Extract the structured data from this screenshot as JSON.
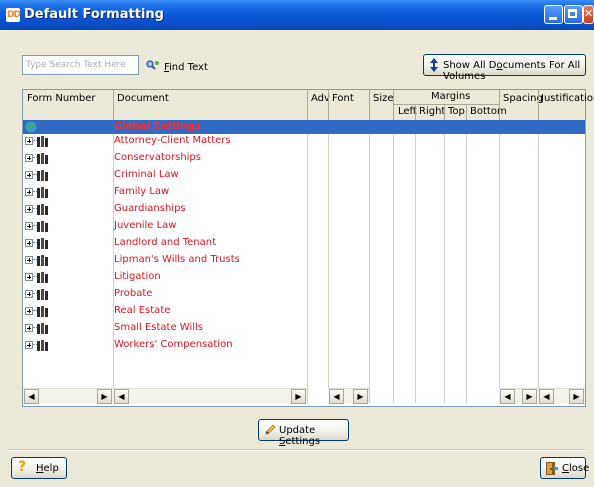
{
  "window": {
    "title": "Default Formatting",
    "icon_text": "DD",
    "controls": [
      "minimize-icon",
      "maximize-icon",
      "close-icon"
    ]
  },
  "search": {
    "placeholder": "Type Search Text Here",
    "find_label": "Find Text",
    "find_accel": "F",
    "find_rest": "ind Text",
    "show_all_label_pre": "Show All D",
    "show_all_accel": "o",
    "show_all_label_post": "cuments For All Volumes"
  },
  "grid": {
    "columns": {
      "form_number": "Form Number",
      "document": "Document",
      "adv": "Adv",
      "font": "Font",
      "size": "Size",
      "margins": "Margins",
      "left": "Left",
      "right": "Right",
      "top": "Top",
      "bottom": "Bottom",
      "spacing": "Spacing",
      "justification": "Justification"
    },
    "selected_row": "Global Settings",
    "rows": [
      "Attorney-Client Matters",
      "Conservatorships",
      "Criminal Law",
      "Family Law",
      "Guardianships",
      "Juvenile Law",
      "Landlord and Tenant",
      "Lipman's Wills and Trusts",
      "Litigation",
      "Probate",
      "Real Estate",
      "Small Estate Wills",
      "Workers' Compensation"
    ]
  },
  "buttons": {
    "update_pre": "Update ",
    "update_accel": "S",
    "update_post": "ettings",
    "help_accel": "H",
    "help_post": "elp",
    "close_accel": "C",
    "close_post": "lose"
  },
  "colors": {
    "title_bar": "#0a58d8",
    "selection": "#316ac5",
    "document_text": "#e0141e"
  }
}
